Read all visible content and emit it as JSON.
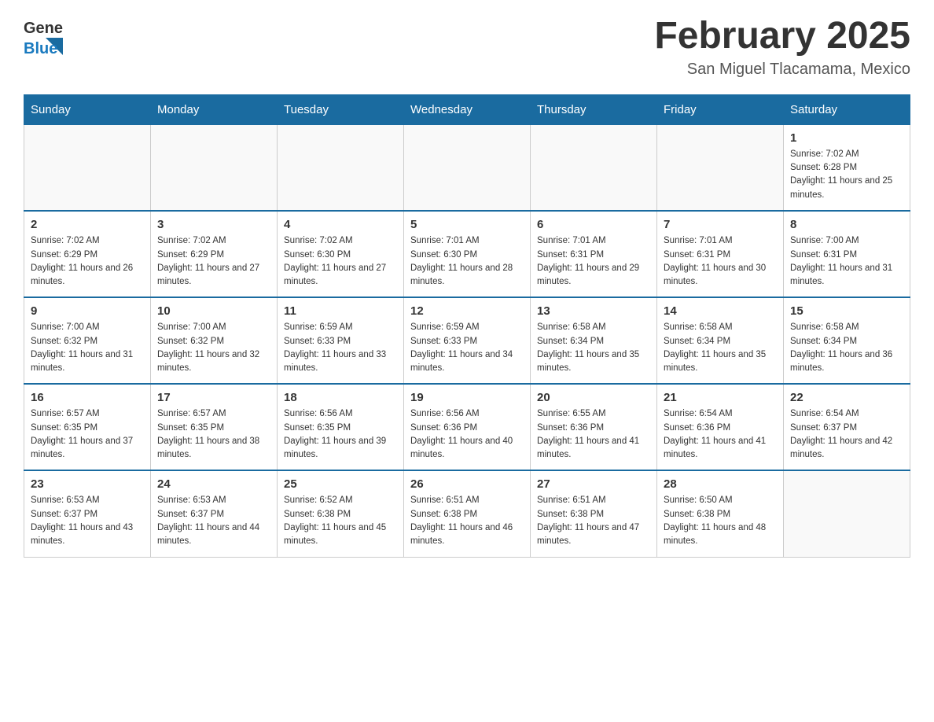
{
  "header": {
    "logo_general": "General",
    "logo_blue": "Blue",
    "title": "February 2025",
    "subtitle": "San Miguel Tlacamama, Mexico"
  },
  "days_of_week": [
    "Sunday",
    "Monday",
    "Tuesday",
    "Wednesday",
    "Thursday",
    "Friday",
    "Saturday"
  ],
  "weeks": [
    [
      {
        "day": "",
        "info": ""
      },
      {
        "day": "",
        "info": ""
      },
      {
        "day": "",
        "info": ""
      },
      {
        "day": "",
        "info": ""
      },
      {
        "day": "",
        "info": ""
      },
      {
        "day": "",
        "info": ""
      },
      {
        "day": "1",
        "sunrise": "7:02 AM",
        "sunset": "6:28 PM",
        "daylight": "11 hours and 25 minutes."
      }
    ],
    [
      {
        "day": "2",
        "sunrise": "7:02 AM",
        "sunset": "6:29 PM",
        "daylight": "11 hours and 26 minutes."
      },
      {
        "day": "3",
        "sunrise": "7:02 AM",
        "sunset": "6:29 PM",
        "daylight": "11 hours and 27 minutes."
      },
      {
        "day": "4",
        "sunrise": "7:02 AM",
        "sunset": "6:30 PM",
        "daylight": "11 hours and 27 minutes."
      },
      {
        "day": "5",
        "sunrise": "7:01 AM",
        "sunset": "6:30 PM",
        "daylight": "11 hours and 28 minutes."
      },
      {
        "day": "6",
        "sunrise": "7:01 AM",
        "sunset": "6:31 PM",
        "daylight": "11 hours and 29 minutes."
      },
      {
        "day": "7",
        "sunrise": "7:01 AM",
        "sunset": "6:31 PM",
        "daylight": "11 hours and 30 minutes."
      },
      {
        "day": "8",
        "sunrise": "7:00 AM",
        "sunset": "6:31 PM",
        "daylight": "11 hours and 31 minutes."
      }
    ],
    [
      {
        "day": "9",
        "sunrise": "7:00 AM",
        "sunset": "6:32 PM",
        "daylight": "11 hours and 31 minutes."
      },
      {
        "day": "10",
        "sunrise": "7:00 AM",
        "sunset": "6:32 PM",
        "daylight": "11 hours and 32 minutes."
      },
      {
        "day": "11",
        "sunrise": "6:59 AM",
        "sunset": "6:33 PM",
        "daylight": "11 hours and 33 minutes."
      },
      {
        "day": "12",
        "sunrise": "6:59 AM",
        "sunset": "6:33 PM",
        "daylight": "11 hours and 34 minutes."
      },
      {
        "day": "13",
        "sunrise": "6:58 AM",
        "sunset": "6:34 PM",
        "daylight": "11 hours and 35 minutes."
      },
      {
        "day": "14",
        "sunrise": "6:58 AM",
        "sunset": "6:34 PM",
        "daylight": "11 hours and 35 minutes."
      },
      {
        "day": "15",
        "sunrise": "6:58 AM",
        "sunset": "6:34 PM",
        "daylight": "11 hours and 36 minutes."
      }
    ],
    [
      {
        "day": "16",
        "sunrise": "6:57 AM",
        "sunset": "6:35 PM",
        "daylight": "11 hours and 37 minutes."
      },
      {
        "day": "17",
        "sunrise": "6:57 AM",
        "sunset": "6:35 PM",
        "daylight": "11 hours and 38 minutes."
      },
      {
        "day": "18",
        "sunrise": "6:56 AM",
        "sunset": "6:35 PM",
        "daylight": "11 hours and 39 minutes."
      },
      {
        "day": "19",
        "sunrise": "6:56 AM",
        "sunset": "6:36 PM",
        "daylight": "11 hours and 40 minutes."
      },
      {
        "day": "20",
        "sunrise": "6:55 AM",
        "sunset": "6:36 PM",
        "daylight": "11 hours and 41 minutes."
      },
      {
        "day": "21",
        "sunrise": "6:54 AM",
        "sunset": "6:36 PM",
        "daylight": "11 hours and 41 minutes."
      },
      {
        "day": "22",
        "sunrise": "6:54 AM",
        "sunset": "6:37 PM",
        "daylight": "11 hours and 42 minutes."
      }
    ],
    [
      {
        "day": "23",
        "sunrise": "6:53 AM",
        "sunset": "6:37 PM",
        "daylight": "11 hours and 43 minutes."
      },
      {
        "day": "24",
        "sunrise": "6:53 AM",
        "sunset": "6:37 PM",
        "daylight": "11 hours and 44 minutes."
      },
      {
        "day": "25",
        "sunrise": "6:52 AM",
        "sunset": "6:38 PM",
        "daylight": "11 hours and 45 minutes."
      },
      {
        "day": "26",
        "sunrise": "6:51 AM",
        "sunset": "6:38 PM",
        "daylight": "11 hours and 46 minutes."
      },
      {
        "day": "27",
        "sunrise": "6:51 AM",
        "sunset": "6:38 PM",
        "daylight": "11 hours and 47 minutes."
      },
      {
        "day": "28",
        "sunrise": "6:50 AM",
        "sunset": "6:38 PM",
        "daylight": "11 hours and 48 minutes."
      },
      {
        "day": "",
        "info": ""
      }
    ]
  ]
}
